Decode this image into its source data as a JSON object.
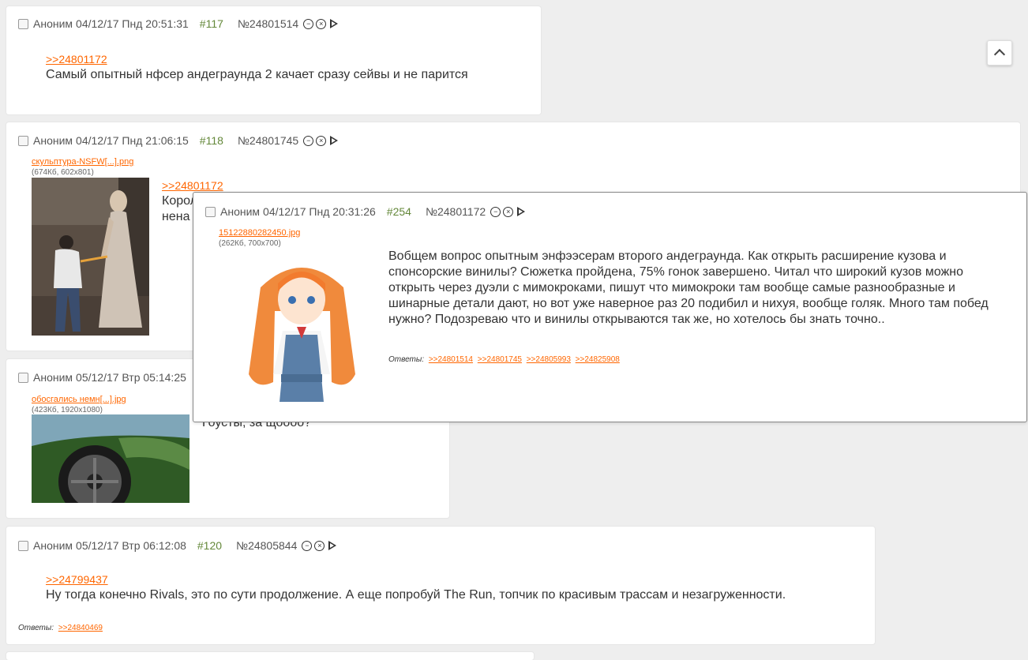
{
  "posts": [
    {
      "author": "Аноним",
      "date": "04/12/17 Пнд 20:51:31",
      "num": "#117",
      "id": "№24801514",
      "reply": ">>24801172",
      "text": "Самый опытный нфсер андеграунда 2 качает сразу сейвы и не парится"
    },
    {
      "author": "Аноним",
      "date": "04/12/17 Пнд 21:06:15",
      "num": "#118",
      "id": "№24801745",
      "file_name": "скульптура-NSFW[...].png",
      "file_meta": "(674Кб, 602x801)",
      "reply": ">>24801172",
      "text_line1": "Корол",
      "text_line2": "нена"
    },
    {
      "author": "Аноним",
      "date": "05/12/17 Втр 05:14:25",
      "file_name": "обосгались немн[...].jpg",
      "file_meta": "(423Кб, 1920x1080)",
      "text": "Гоусты, за щоооо?"
    },
    {
      "author": "Аноним",
      "date": "05/12/17 Втр 06:12:08",
      "num": "#120",
      "id": "№24805844",
      "reply": ">>24799437",
      "text": "Ну тогда конечно Rivals, это по сути продолжение. А еще попробуй The Run, топчик по красивым трассам и незагруженности.",
      "answers_label": "Ответы:",
      "answers": [
        ">>24840469"
      ]
    }
  ],
  "popup": {
    "author": "Аноним",
    "date": "04/12/17 Пнд 20:31:26",
    "num": "#254",
    "id": "№24801172",
    "file_name": "15122880282450.jpg",
    "file_meta": "(262Кб, 700x700)",
    "text": "Вобщем вопрос опытным энфээсерам второго андеграунда. Как открыть расширение кузова и спонсорские винилы? Сюжетка пройдена, 75% гонок завершено. Читал что широкий кузов можно открыть через дуэли с мимокроками, пишут что мимокроки там вообще самые разнообразные и шинарные детали дают, но вот уже наверное раз 20 подибил и нихуя, вообще голяк. Много там побед нужно? Подозреваю что и винилы открываются так же, но хотелось бы знать точно..",
    "answers_label": "Ответы:",
    "answers": [
      ">>24801514",
      ">>24801745",
      ">>24805993",
      ">>24825908"
    ]
  },
  "icons": {
    "hide": "minus-circle-icon",
    "report": "x-circle-icon",
    "play": "play-icon",
    "up": "chevron-up-icon"
  },
  "colors": {
    "link": "#ff6600",
    "post_number": "#64883a",
    "background": "#eeeeee"
  }
}
